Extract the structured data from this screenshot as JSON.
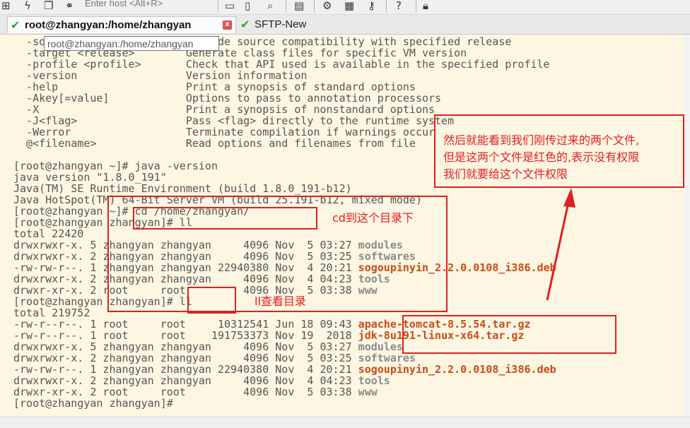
{
  "toolbar": {
    "host_placeholder": "Enter host <Alt+R>",
    "icons": [
      "grid-icon",
      "lightning-icon",
      "duplicate-icon",
      "link-icon",
      "new-file-icon",
      "file-icon",
      "find-icon",
      "print-icon",
      "settings-icon",
      "keyboard-icon",
      "key-icon",
      "help-icon",
      "lock-icon"
    ]
  },
  "tabs": [
    {
      "label": "root@zhangyan:/home/zhangyan",
      "active": true,
      "close": "x"
    },
    {
      "label": "SFTP-New",
      "active": false
    }
  ],
  "tooltip": "root@zhangyan:/home/zhangyan",
  "terminal": {
    "lines": [
      [
        {
          "t": "  -source <release>        Provide source compatibility with specified release"
        }
      ],
      [
        {
          "t": "  -target <release>        Generate class files for specific VM version"
        }
      ],
      [
        {
          "t": "  -profile <profile>       Check that API used is available in the specified profile"
        }
      ],
      [
        {
          "t": "  -version                 Version information"
        }
      ],
      [
        {
          "t": "  -help                    Print a synopsis of standard options"
        }
      ],
      [
        {
          "t": "  -Akey[=value]            Options to pass to annotation processors"
        }
      ],
      [
        {
          "t": "  -X                       Print a synopsis of nonstandard options"
        }
      ],
      [
        {
          "t": "  -J<flag>                 Pass <flag> directly to the runtime system"
        }
      ],
      [
        {
          "t": "  -Werror                  Terminate compilation if warnings occur"
        }
      ],
      [
        {
          "t": "  @<filename>              Read options and filenames from file"
        }
      ],
      [
        {
          "t": ""
        }
      ],
      [
        {
          "t": "[root@zhangyan ~]# java -version"
        }
      ],
      [
        {
          "t": "java version \"1.8.0_191\""
        }
      ],
      [
        {
          "t": "Java(TM) SE Runtime Environment (build 1.8.0_191-b12)"
        }
      ],
      [
        {
          "t": "Java HotSpot(TM) 64-Bit Server VM (build 25.191-b12, mixed mode)"
        }
      ],
      [
        {
          "t": "[root@zhangyan ~]# cd /home/zhangyan/"
        }
      ],
      [
        {
          "t": "[root@zhangyan zhangyan]# ll"
        }
      ],
      [
        {
          "t": "total 22420"
        }
      ],
      [
        {
          "t": "drwxrwxr-x. 5 zhangyan zhangyan     4096 Nov  5 03:27 "
        },
        {
          "t": "modules",
          "c": "dir"
        }
      ],
      [
        {
          "t": "drwxrwxr-x. 2 zhangyan zhangyan     4096 Nov  5 03:25 "
        },
        {
          "t": "softwares",
          "c": "dir"
        }
      ],
      [
        {
          "t": "-rw-rw-r--. 1 zhangyan zhangyan 22940380 Nov  4 20:21 "
        },
        {
          "t": "sogoupinyin_2.2.0.0108_i386.deb",
          "c": "deb"
        }
      ],
      [
        {
          "t": "drwxrwxr-x. 2 zhangyan zhangyan     4096 Nov  4 04:23 "
        },
        {
          "t": "tools",
          "c": "dir"
        }
      ],
      [
        {
          "t": "drwxr-xr-x. 2 root     root         4096 Nov  5 03:38 "
        },
        {
          "t": "www",
          "c": "dir"
        }
      ],
      [
        {
          "t": "[root@zhangyan zhangyan]# ll"
        }
      ],
      [
        {
          "t": "total 219752"
        }
      ],
      [
        {
          "t": "-rw-r--r--. 1 root     root     10312541 Jun 18 09:43 "
        },
        {
          "t": "apache-tomcat-8.5.54.tar.gz",
          "c": "gz"
        }
      ],
      [
        {
          "t": "-rw-r--r--. 1 root     root    191753373 Nov 19  2018 "
        },
        {
          "t": "jdk-8u191-linux-x64.tar.gz",
          "c": "gz"
        }
      ],
      [
        {
          "t": "drwxrwxr-x. 5 zhangyan zhangyan     4096 Nov  5 03:27 "
        },
        {
          "t": "modules",
          "c": "dir"
        }
      ],
      [
        {
          "t": "drwxrwxr-x. 2 zhangyan zhangyan     4096 Nov  5 03:25 "
        },
        {
          "t": "softwares",
          "c": "dir"
        }
      ],
      [
        {
          "t": "-rw-rw-r--. 1 zhangyan zhangyan 22940380 Nov  4 20:21 "
        },
        {
          "t": "sogoupinyin_2.2.0.0108_i386.deb",
          "c": "deb"
        }
      ],
      [
        {
          "t": "drwxrwxr-x. 2 zhangyan zhangyan     4096 Nov  4 04:23 "
        },
        {
          "t": "tools",
          "c": "dir"
        }
      ],
      [
        {
          "t": "drwxr-xr-x. 2 root     root         4096 Nov  5 03:38 "
        },
        {
          "t": "www",
          "c": "dir"
        }
      ],
      [
        {
          "t": "[root@zhangyan zhangyan]# "
        }
      ]
    ]
  },
  "annotations": {
    "note1_line1": "然后就能看到我们刚传过来的两个文件,",
    "note1_line2": "但是这两个文件是红色的,表示没有权限",
    "note1_line3": "我们就要给这个文件权限",
    "note2": "cd到这个目录下",
    "note3": "ll查看目录",
    "color": "#e02020"
  }
}
